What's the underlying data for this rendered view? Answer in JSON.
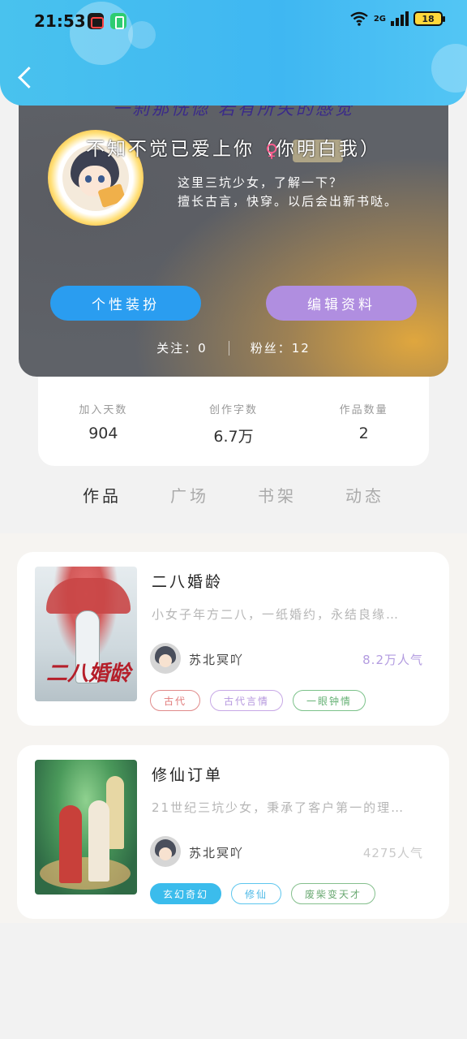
{
  "status_bar": {
    "time": "21:53",
    "network": "2G",
    "battery": "18"
  },
  "profile": {
    "mood": "一刹那恍惚 若有所失的感觉",
    "nickname": "不知不觉已爱上你（你明白我）",
    "gender_icon": "female-symbol",
    "bio_line1": "这里三坑少女，了解一下？",
    "bio_line2": "擅长古言，快穿。以后会出新书哒。",
    "dress_button": "个性装扮",
    "edit_button": "编辑资料",
    "following": "关注：0",
    "fans": "粉丝：12"
  },
  "stats": [
    {
      "label": "加入天数",
      "value": "904"
    },
    {
      "label": "创作字数",
      "value": "6.7万"
    },
    {
      "label": "作品数量",
      "value": "2"
    }
  ],
  "tabs": [
    {
      "label": "作品",
      "active": true
    },
    {
      "label": "广场",
      "active": false
    },
    {
      "label": "书架",
      "active": false
    },
    {
      "label": "动态",
      "active": false
    }
  ],
  "books": [
    {
      "title": "二八婚龄",
      "cover_text": "二八婚龄",
      "desc": "小女子年方二八，一纸婚约，永结良缘…",
      "author": "苏北冥吖",
      "popularity": "8.2万人气",
      "tags": [
        "古代",
        "古代言情",
        "一眼钟情"
      ]
    },
    {
      "title": "修仙订单",
      "desc": "21世纪三坑少女，秉承了客户第一的理…",
      "author": "苏北冥吖",
      "popularity": "4275人气",
      "tags": [
        "玄幻奇幻",
        "修仙",
        "废柴变天才"
      ]
    }
  ],
  "colors": {
    "header": "#49c2ee",
    "dress_button": "#2a9df0",
    "edit_button": "#b08ee0",
    "tab_indicator": "#b79de6",
    "popularity_accent": "#b39ce0"
  }
}
